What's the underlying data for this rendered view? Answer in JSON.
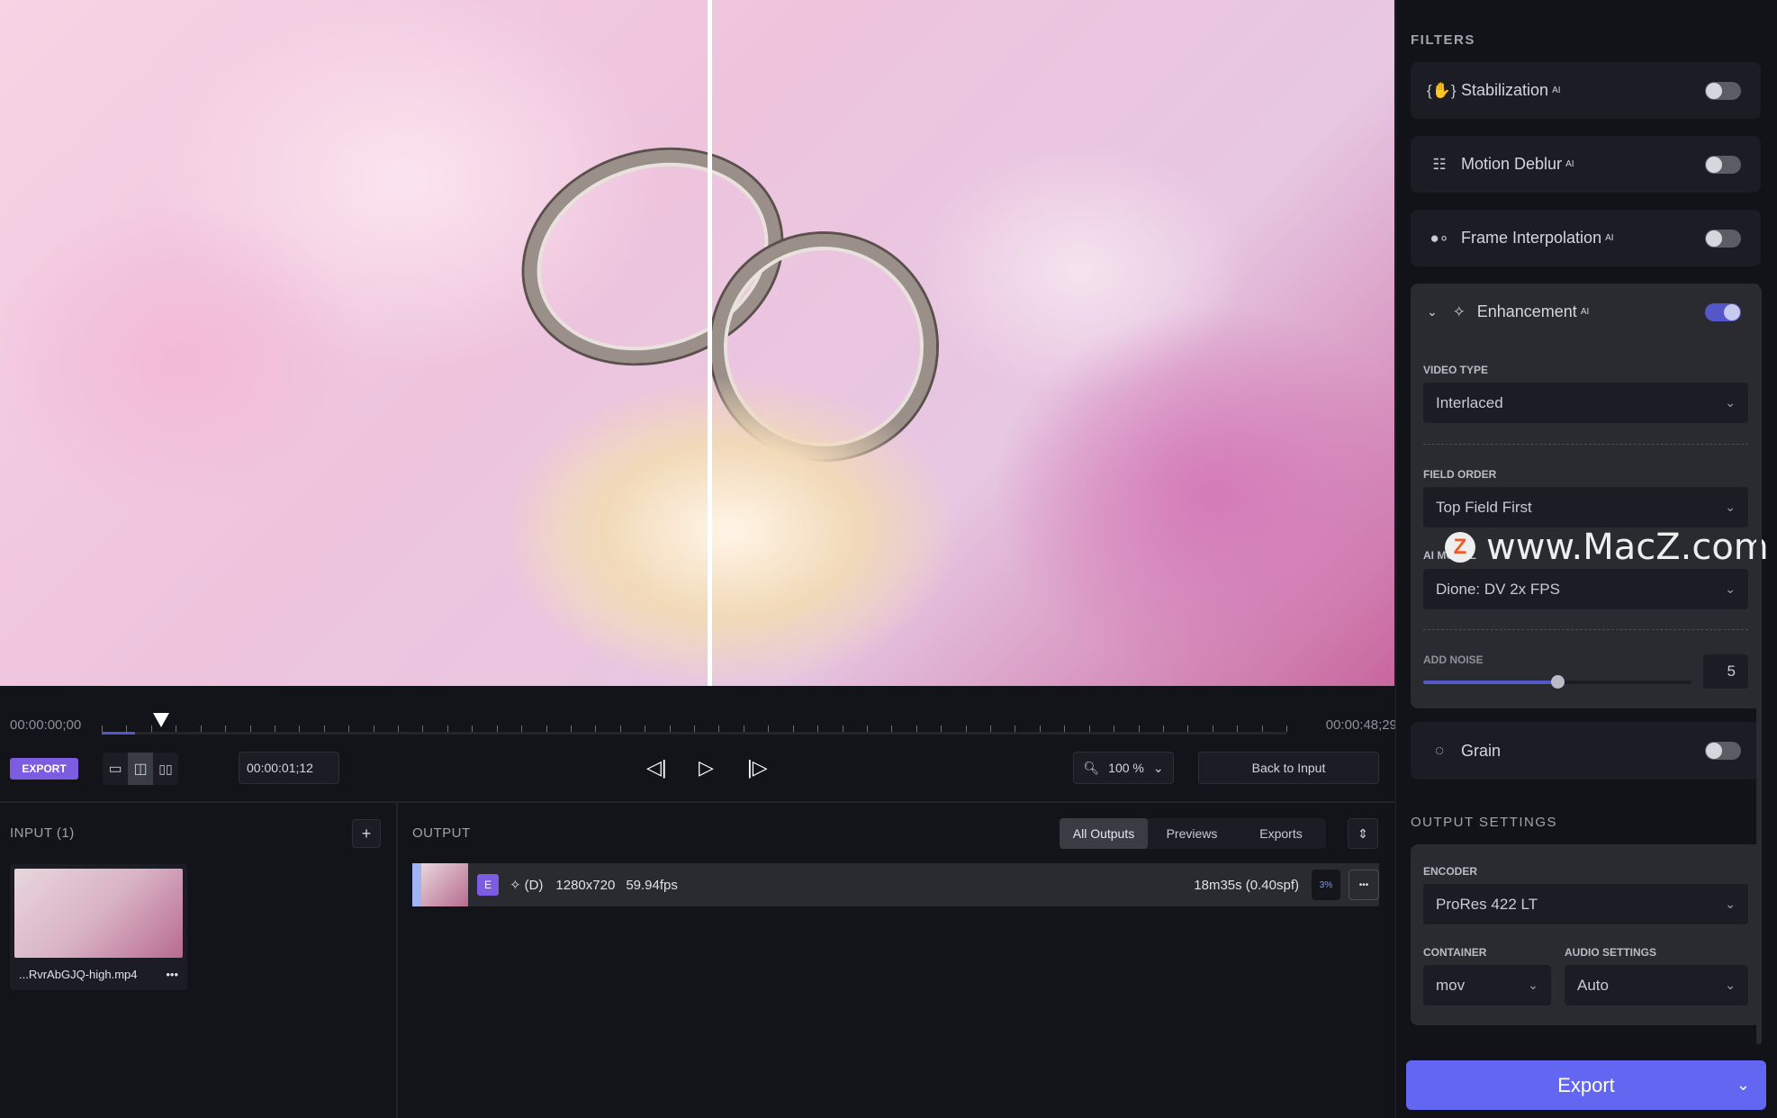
{
  "timeline": {
    "start": "00:00:00;00",
    "end": "00:00:48;29",
    "progress_fraction": 0.028
  },
  "controls": {
    "export_badge": "EXPORT",
    "timecode": "00:00:01;12",
    "zoom": "100 %",
    "back_to_input": "Back to Input"
  },
  "input": {
    "title": "INPUT (1)",
    "file": "...RvrAbGJQ-high.mp4",
    "more": "•••"
  },
  "output": {
    "title": "OUTPUT",
    "tabs": [
      "All Outputs",
      "Previews",
      "Exports"
    ],
    "active_tab": "All Outputs",
    "row": {
      "badge": "E",
      "mode": "(D)",
      "resolution": "1280x720",
      "fps": "59.94fps",
      "eta": "18m35s (0.40spf)",
      "percent": "3%",
      "more": "•••"
    }
  },
  "filters": {
    "title": "FILTERS",
    "items": [
      {
        "name": "Stabilization",
        "ai": "AI",
        "icon": "stabilization-icon",
        "enabled": false
      },
      {
        "name": "Motion Deblur",
        "ai": "AI",
        "icon": "motion-deblur-icon",
        "enabled": false
      },
      {
        "name": "Frame Interpolation",
        "ai": "AI",
        "icon": "frame-interpolation-icon",
        "enabled": false
      },
      {
        "name": "Enhancement",
        "ai": "AI",
        "icon": "sparkle-icon",
        "enabled": true
      },
      {
        "name": "Grain",
        "icon": "grain-icon",
        "enabled": false
      }
    ],
    "enhancement": {
      "video_type_label": "VIDEO TYPE",
      "video_type": "Interlaced",
      "field_order_label": "FIELD ORDER",
      "field_order": "Top Field First",
      "ai_model_label": "AI MODEL",
      "ai_model": "Dione: DV 2x FPS",
      "add_noise_label": "ADD NOISE",
      "add_noise": "5",
      "add_noise_fraction": 0.5
    }
  },
  "output_settings": {
    "title": "OUTPUT SETTINGS",
    "encoder_label": "ENCODER",
    "encoder": "ProRes 422 LT",
    "container_label": "CONTAINER",
    "container": "mov",
    "audio_label": "AUDIO SETTINGS",
    "audio": "Auto"
  },
  "export_button": "Export",
  "watermark": "www.MacZ.com",
  "colors": {
    "accent": "#6366f1",
    "export_badge": "#7c5ce0",
    "toggle_on": "#5457c8"
  }
}
